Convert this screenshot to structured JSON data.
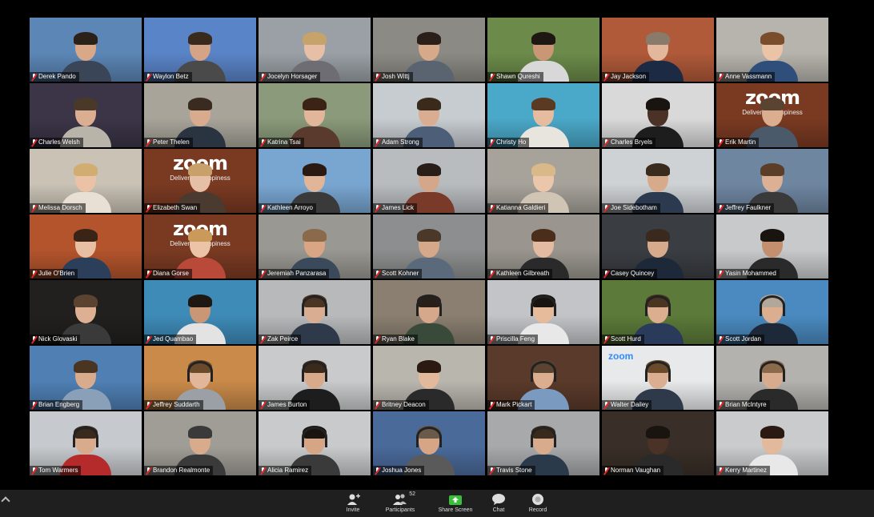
{
  "participants": [
    {
      "name": "Derek Pando",
      "bg": "#5b86b5",
      "skin": "#d9a889",
      "hair": "#2b2118",
      "shirt": "#3a4657"
    },
    {
      "name": "Waylon Betz",
      "bg": "#5a84c8",
      "skin": "#d5a386",
      "hair": "#3a2a1e",
      "shirt": "#4a4a4a"
    },
    {
      "name": "Jocelyn Horsager",
      "bg": "#9aa0a6",
      "skin": "#e6bfa6",
      "hair": "#c6a36a",
      "shirt": "#6d6d73"
    },
    {
      "name": "Josh Wittj",
      "bg": "#8c8a84",
      "skin": "#d6a98b",
      "hair": "#2a2019",
      "shirt": "#5a6470"
    },
    {
      "name": "Shawn Qureshi",
      "bg": "#6c8b4a",
      "skin": "#c99776",
      "hair": "#1f1712",
      "shirt": "#d8d8d8"
    },
    {
      "name": "Jay Jackson",
      "bg": "#b05a3a",
      "skin": "#e3b79b",
      "hair": "#8a7a6a",
      "shirt": "#1d2a44"
    },
    {
      "name": "Anne Vassmann",
      "bg": "#b7b4ad",
      "skin": "#ebc3a7",
      "hair": "#7a4d2c",
      "shirt": "#2f4e7a"
    },
    {
      "name": "Charles Welsh",
      "bg": "#3b3547",
      "skin": "#dcae91",
      "hair": "#4a3828",
      "shirt": "#b9b4aa"
    },
    {
      "name": "Peter Thelen",
      "bg": "#a8a49a",
      "skin": "#d8ab8e",
      "hair": "#3a2b20",
      "shirt": "#2a3340"
    },
    {
      "name": "Katrina Tsai",
      "bg": "#8a9a7a",
      "skin": "#e1b69a",
      "hair": "#3b2415",
      "shirt": "#5b3a2e"
    },
    {
      "name": "Adam Strong",
      "bg": "#c7ccd1",
      "skin": "#d9ad91",
      "hair": "#3a2a1c",
      "shirt": "#4d5f78"
    },
    {
      "name": "Christy Ho",
      "bg": "#4aa8c8",
      "skin": "#e5bca0",
      "hair": "#5a3a22",
      "shirt": "#e8e4de"
    },
    {
      "name": "Charles Bryels",
      "bg": "#d9d9d9",
      "skin": "#4a3226",
      "hair": "#1a1410",
      "shirt": "#1d1d1d"
    },
    {
      "name": "Erik Martin",
      "bg": "#7a3a22",
      "skin": "#dcae90",
      "hair": "#5a4330",
      "shirt": "#4a5a6a",
      "logo": "zoom",
      "logo_sub": "Delivering Happiness"
    },
    {
      "name": "Melissa Dorsch",
      "bg": "#c9c2b5",
      "skin": "#ebc2a5",
      "hair": "#d2ad72",
      "shirt": "#e8e0d4"
    },
    {
      "name": "Elizabeth Swan",
      "bg": "#7a3a22",
      "skin": "#e6c0a6",
      "hair": "#c7a06a",
      "shirt": "#4a3a30",
      "logo": "zoom",
      "logo_sub": "Delivering Happiness"
    },
    {
      "name": "Kathleen Arroyo",
      "bg": "#79a6d1",
      "skin": "#e0b598",
      "hair": "#2a1a12",
      "shirt": "#3a3a3a"
    },
    {
      "name": "James Lick",
      "bg": "#b9bcbf",
      "skin": "#d5a78a",
      "hair": "#2a1f18",
      "shirt": "#7a3a2a"
    },
    {
      "name": "Katianna Galdieri",
      "bg": "#a7a39b",
      "skin": "#ebc6ab",
      "hair": "#d9b98a",
      "shirt": "#d0c4b4"
    },
    {
      "name": "Joe Sidebotham",
      "bg": "#cfd2d5",
      "skin": "#d8aa8c",
      "hair": "#3a2b1f",
      "shirt": "#2b3a4e"
    },
    {
      "name": "Jeffrey Faulkner",
      "bg": "#6f86a1",
      "skin": "#dbb094",
      "hair": "#5a3e27",
      "shirt": "#3a3a3a"
    },
    {
      "name": "Julie O'Brien",
      "bg": "#b3542c",
      "skin": "#e8bfa3",
      "hair": "#3a2415",
      "shirt": "#2b3f5a"
    },
    {
      "name": "Diana Gorse",
      "bg": "#7a3a22",
      "skin": "#ebc3a7",
      "hair": "#c99a5a",
      "shirt": "#b94a3a",
      "logo": "zoom",
      "logo_sub": "Delivering Happiness"
    },
    {
      "name": "Jeremiah Panzarasa",
      "bg": "#9a9892",
      "skin": "#d9a585",
      "hair": "#8a6a4a",
      "shirt": "#3a4a5a"
    },
    {
      "name": "Scott Kohner",
      "bg": "#8d8e8f",
      "skin": "#d6a88a",
      "hair": "#4a3828",
      "shirt": "#5a6a7a"
    },
    {
      "name": "Kathleen Gilbreath",
      "bg": "#9a968f",
      "skin": "#e4bba0",
      "hair": "#4a2d1a",
      "shirt": "#2a2a2a"
    },
    {
      "name": "Casey Quincey",
      "bg": "#3a3d42",
      "skin": "#d8aa8d",
      "hair": "#3a2a1e",
      "shirt": "#1d2838"
    },
    {
      "name": "Yasin Mohammed",
      "bg": "#c8c9cb",
      "skin": "#c48f6e",
      "hair": "#1a1410",
      "shirt": "#2a2a2a"
    },
    {
      "name": "Nick Glovaski",
      "bg": "#22201e",
      "skin": "#ddb093",
      "hair": "#5a4330",
      "shirt": "#3a3a3a"
    },
    {
      "name": "Jed Quambao",
      "bg": "#3e8bb8",
      "skin": "#c99676",
      "hair": "#1f1712",
      "shirt": "#e3e3e3"
    },
    {
      "name": "Zak Peirce",
      "bg": "#b8b9bb",
      "skin": "#d9ad91",
      "hair": "#4a3422",
      "shirt": "#2e3a4a",
      "headset": true
    },
    {
      "name": "Ryan Blake",
      "bg": "#8a7f70",
      "skin": "#d5a88b",
      "hair": "#2a1f18",
      "shirt": "#3a4a3a",
      "headset": true
    },
    {
      "name": "Priscilla Feng",
      "bg": "#c2c4c7",
      "skin": "#e5bb9c",
      "hair": "#1a1410",
      "shirt": "#e8e8e8",
      "headset": true
    },
    {
      "name": "Scott Hurd",
      "bg": "#5c7a3a",
      "skin": "#dcae90",
      "hair": "#4a3422",
      "shirt": "#2a3a5a",
      "headset": true
    },
    {
      "name": "Scott Jordan",
      "bg": "#4a8ac0",
      "skin": "#dcae90",
      "hair": "#b3a79a",
      "shirt": "#1d2838",
      "headset": true
    },
    {
      "name": "Brian Engberg",
      "bg": "#4f7fb3",
      "skin": "#d9ab8d",
      "hair": "#4a3422",
      "shirt": "#8aa0b8"
    },
    {
      "name": "Jeffrey Suddarth",
      "bg": "#c98a4a",
      "skin": "#e2b698",
      "hair": "#6a4a2a",
      "shirt": "#9aa0a6",
      "headset": true
    },
    {
      "name": "James Burton",
      "bg": "#c9cacb",
      "skin": "#d8aa8c",
      "hair": "#3a2a1c",
      "shirt": "#1d1d1d",
      "headset": true
    },
    {
      "name": "Britney Deacon",
      "bg": "#b9b6ae",
      "skin": "#e3b99c",
      "hair": "#2a1a12",
      "shirt": "#2a2a2a"
    },
    {
      "name": "Mark Pickart",
      "bg": "#5a3a2a",
      "skin": "#dcae90",
      "hair": "#5a4330",
      "shirt": "#7a9ac0",
      "headset": true
    },
    {
      "name": "Walter Dailey",
      "bg": "#e8e9ea",
      "skin": "#dcae90",
      "hair": "#6a4a2a",
      "shirt": "#2e3a4a",
      "logo_small": "zoom",
      "headset": true
    },
    {
      "name": "Brian McIntyre",
      "bg": "#b3b2ae",
      "skin": "#d9ab8d",
      "hair": "#8a6a4a",
      "shirt": "#2a2a2a",
      "headset": true
    },
    {
      "name": "Tom Warmers",
      "bg": "#c6c9cd",
      "skin": "#d9ab8d",
      "hair": "#3a2a1c",
      "shirt": "#b52a2a",
      "headset": true
    },
    {
      "name": "Brandon Realmonte",
      "bg": "#a09d96",
      "skin": "#d9ab8d",
      "hair": "#3a3a3a",
      "shirt": "#3a3a3a"
    },
    {
      "name": "Alicia Ramirez",
      "bg": "#c9cacb",
      "skin": "#d6a585",
      "hair": "#1a1410",
      "shirt": "#3a3a3a",
      "headset": true
    },
    {
      "name": "Joshua Jones",
      "bg": "#4a6a9a",
      "skin": "#d6a585",
      "hair": "#6a5a4a",
      "shirt": "#5a5a5a",
      "headset": true
    },
    {
      "name": "Travis Stone",
      "bg": "#a7a9ab",
      "skin": "#d9ab8d",
      "hair": "#3a2a1c",
      "shirt": "#2a3a4a",
      "headset": true
    },
    {
      "name": "Norman Vaughan",
      "bg": "#3a2f28",
      "skin": "#4a3226",
      "hair": "#1a1410",
      "shirt": "#2a2a2a",
      "active": true
    },
    {
      "name": "Kerry Martinez",
      "bg": "#c9cbcd",
      "skin": "#e3b99c",
      "hair": "#2a1a12",
      "shirt": "#e8e8e8"
    }
  ],
  "toolbar": {
    "invite": "Invite",
    "participants": "Participants",
    "participants_count": "52",
    "share": "Share Screen",
    "chat": "Chat",
    "record": "Record"
  },
  "icons": {
    "invite": "invite-icon",
    "participants": "participants-icon",
    "share": "share-screen-icon",
    "chat": "chat-icon",
    "record": "record-icon"
  },
  "colors": {
    "active_speaker": "#e3d44a",
    "share_green": "#3bbf3b",
    "muted_red": "#e02828"
  }
}
